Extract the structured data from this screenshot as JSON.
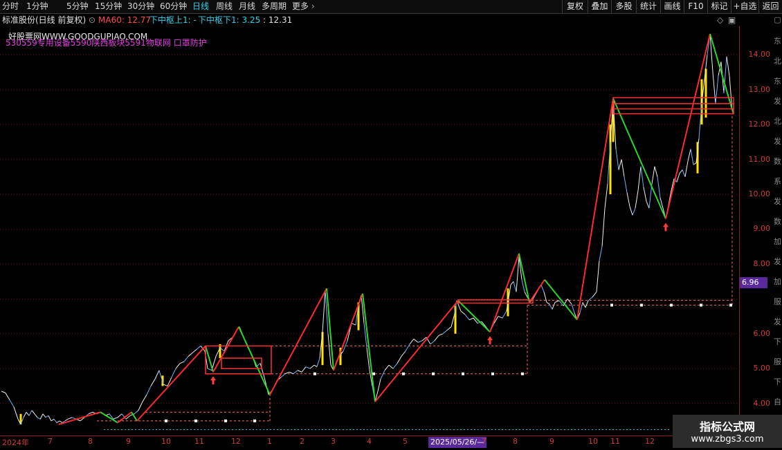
{
  "toolbar": {
    "left_items": [
      {
        "label": "分时",
        "x": 3
      },
      {
        "label": "1分钟",
        "x": 38
      },
      {
        "label": "5分钟",
        "x": 96
      },
      {
        "label": "15分钟",
        "x": 137
      },
      {
        "label": "30分钟",
        "x": 184
      },
      {
        "label": "60分钟",
        "x": 231
      },
      {
        "label": "日线",
        "x": 278
      },
      {
        "label": "周线",
        "x": 312
      },
      {
        "label": "月线",
        "x": 345
      },
      {
        "label": "多周期",
        "x": 378
      },
      {
        "label": "更多",
        "x": 422
      }
    ],
    "more_caret": "›",
    "active": "日线",
    "right_items": [
      "复权",
      "叠加",
      "多股",
      "统计",
      "画线",
      "F10",
      "标记",
      "+自选",
      "返回"
    ]
  },
  "info": {
    "title": "标准股份(日线 前复权)",
    "ma": "MA60: 12.77",
    "zs_up": "下中枢上1: -",
    "zs_down": "下中枢下1: 3.25",
    "val": ": 12.31",
    "site_watermark": "好股票网WWW.GOODGUPIAO.COM",
    "concepts": "530559专用设备5590陕西板块5591物联网 口罩防护"
  },
  "colors": {
    "up": "#ff2a2a",
    "down": "#28d82a",
    "price_line": "#f0f0f0",
    "price_line_alt": "#6fb4ff",
    "yellow_bar": "#ffe200",
    "box": "#ff3030",
    "axis_label": "#d23c3c",
    "accent": "#27d3f0",
    "badge": "#5a2a9c"
  },
  "yaxis": {
    "labels": [
      "14.00",
      "13.00",
      "12.00",
      "11.00",
      "10.00",
      "9.00",
      "8.00",
      "6.00",
      "5.00",
      "4.00"
    ],
    "current_price": "6.96"
  },
  "xaxis": {
    "labels": [
      "2024年",
      "7",
      "8",
      "9",
      "10",
      "11",
      "12",
      "1",
      "2",
      "3",
      "4",
      "5",
      "7",
      "8",
      "9",
      "10",
      "11",
      "12"
    ],
    "date_badge": "2025/05/26/—"
  },
  "right_strip": [
    "▢",
    "东",
    "北",
    "东",
    "发",
    "北",
    "发",
    "数",
    "系",
    "发",
    "数",
    "加",
    "发",
    "加",
    "服",
    "发",
    "下",
    "服",
    "下",
    "自",
    "农"
  ],
  "watermark": {
    "line1": "指标公式网",
    "line2": "www.zbgs3.com"
  },
  "chart_data": {
    "type": "line",
    "ylim": [
      3.2,
      14.7
    ],
    "x_range": [
      0,
      1060
    ],
    "price_series": [
      [
        2,
        4.35
      ],
      [
        8,
        4.3
      ],
      [
        14,
        4.1
      ],
      [
        20,
        3.9
      ],
      [
        26,
        3.55
      ],
      [
        30,
        3.4
      ],
      [
        34,
        3.6
      ],
      [
        38,
        3.75
      ],
      [
        42,
        3.65
      ],
      [
        46,
        3.8
      ],
      [
        50,
        3.7
      ],
      [
        54,
        3.6
      ],
      [
        58,
        3.55
      ],
      [
        62,
        3.7
      ],
      [
        66,
        3.6
      ],
      [
        70,
        3.65
      ],
      [
        74,
        3.5
      ],
      [
        78,
        3.55
      ],
      [
        82,
        3.45
      ],
      [
        86,
        3.5
      ],
      [
        90,
        3.45
      ],
      [
        94,
        3.5
      ],
      [
        98,
        3.55
      ],
      [
        104,
        3.6
      ],
      [
        110,
        3.55
      ],
      [
        116,
        3.5
      ],
      [
        122,
        3.6
      ],
      [
        128,
        3.7
      ],
      [
        134,
        3.75
      ],
      [
        140,
        3.7
      ],
      [
        146,
        3.75
      ],
      [
        152,
        3.65
      ],
      [
        158,
        3.7
      ],
      [
        164,
        3.55
      ],
      [
        170,
        3.6
      ],
      [
        176,
        3.7
      ],
      [
        182,
        3.55
      ],
      [
        188,
        3.65
      ],
      [
        194,
        3.7
      ],
      [
        200,
        3.8
      ],
      [
        206,
        4.05
      ],
      [
        212,
        4.25
      ],
      [
        218,
        4.5
      ],
      [
        224,
        4.7
      ],
      [
        230,
        4.95
      ],
      [
        236,
        4.55
      ],
      [
        242,
        4.5
      ],
      [
        248,
        4.75
      ],
      [
        254,
        5.0
      ],
      [
        260,
        5.15
      ],
      [
        266,
        5.2
      ],
      [
        272,
        5.35
      ],
      [
        278,
        5.45
      ],
      [
        284,
        5.55
      ],
      [
        290,
        5.65
      ],
      [
        296,
        5.5
      ],
      [
        300,
        5.0
      ],
      [
        306,
        4.95
      ],
      [
        312,
        5.35
      ],
      [
        318,
        5.6
      ],
      [
        324,
        5.5
      ],
      [
        330,
        5.8
      ],
      [
        336,
        5.9
      ],
      [
        342,
        6.1
      ],
      [
        346,
        6.2
      ],
      [
        352,
        5.9
      ],
      [
        358,
        5.6
      ],
      [
        364,
        5.4
      ],
      [
        370,
        5.05
      ],
      [
        376,
        5.15
      ],
      [
        382,
        4.75
      ],
      [
        388,
        4.25
      ],
      [
        394,
        4.4
      ],
      [
        400,
        4.65
      ],
      [
        406,
        4.75
      ],
      [
        412,
        4.85
      ],
      [
        418,
        4.9
      ],
      [
        424,
        4.85
      ],
      [
        430,
        4.95
      ],
      [
        436,
        4.9
      ],
      [
        442,
        5.05
      ],
      [
        448,
        5.0
      ],
      [
        454,
        5.1
      ],
      [
        458,
        5.05
      ],
      [
        462,
        5.3
      ],
      [
        466,
        6.05
      ],
      [
        470,
        7.25
      ],
      [
        474,
        6.0
      ],
      [
        478,
        5.1
      ],
      [
        482,
        4.95
      ],
      [
        486,
        5.2
      ],
      [
        490,
        5.35
      ],
      [
        496,
        5.5
      ],
      [
        502,
        5.8
      ],
      [
        508,
        6.3
      ],
      [
        514,
        6.25
      ],
      [
        518,
        6.85
      ],
      [
        522,
        7.1
      ],
      [
        526,
        6.3
      ],
      [
        530,
        5.6
      ],
      [
        534,
        4.95
      ],
      [
        538,
        4.5
      ],
      [
        542,
        4.05
      ],
      [
        546,
        4.35
      ],
      [
        550,
        4.7
      ],
      [
        556,
        4.95
      ],
      [
        562,
        5.1
      ],
      [
        568,
        5.0
      ],
      [
        574,
        5.15
      ],
      [
        580,
        5.35
      ],
      [
        586,
        5.5
      ],
      [
        592,
        5.7
      ],
      [
        598,
        5.85
      ],
      [
        604,
        5.75
      ],
      [
        610,
        5.8
      ],
      [
        616,
        5.9
      ],
      [
        622,
        5.7
      ],
      [
        628,
        5.8
      ],
      [
        634,
        5.95
      ],
      [
        640,
        6.0
      ],
      [
        646,
        6.1
      ],
      [
        652,
        6.2
      ],
      [
        656,
        6.5
      ],
      [
        660,
        6.95
      ],
      [
        666,
        6.65
      ],
      [
        672,
        6.55
      ],
      [
        678,
        6.4
      ],
      [
        684,
        6.45
      ],
      [
        690,
        6.3
      ],
      [
        696,
        6.35
      ],
      [
        702,
        6.2
      ],
      [
        708,
        6.05
      ],
      [
        714,
        6.3
      ],
      [
        720,
        6.5
      ],
      [
        726,
        6.45
      ],
      [
        732,
        6.65
      ],
      [
        738,
        7.4
      ],
      [
        742,
        7.5
      ],
      [
        746,
        7.2
      ],
      [
        750,
        8.2
      ],
      [
        754,
        7.55
      ],
      [
        758,
        7.2
      ],
      [
        762,
        7.05
      ],
      [
        766,
        6.9
      ],
      [
        770,
        7.0
      ],
      [
        776,
        7.2
      ],
      [
        782,
        7.4
      ],
      [
        786,
        7.2
      ],
      [
        790,
        6.9
      ],
      [
        794,
        6.85
      ],
      [
        798,
        6.7
      ],
      [
        802,
        6.9
      ],
      [
        808,
        6.95
      ],
      [
        814,
        6.8
      ],
      [
        820,
        7.0
      ],
      [
        826,
        6.85
      ],
      [
        830,
        6.6
      ],
      [
        834,
        6.4
      ],
      [
        838,
        6.6
      ],
      [
        842,
        6.9
      ],
      [
        846,
        6.75
      ],
      [
        850,
        6.95
      ],
      [
        856,
        7.05
      ],
      [
        862,
        7.2
      ],
      [
        866,
        8.1
      ],
      [
        870,
        8.5
      ],
      [
        874,
        9.6
      ],
      [
        878,
        10.3
      ],
      [
        882,
        11.5
      ],
      [
        886,
        12.7
      ],
      [
        890,
        11.3
      ],
      [
        894,
        10.7
      ],
      [
        898,
        11.0
      ],
      [
        902,
        10.5
      ],
      [
        906,
        10.05
      ],
      [
        910,
        9.65
      ],
      [
        914,
        9.4
      ],
      [
        918,
        9.6
      ],
      [
        922,
        10.1
      ],
      [
        926,
        10.8
      ],
      [
        930,
        10.2
      ],
      [
        934,
        9.8
      ],
      [
        938,
        9.6
      ],
      [
        942,
        10.3
      ],
      [
        946,
        10.8
      ],
      [
        950,
        10.5
      ],
      [
        954,
        9.9
      ],
      [
        958,
        9.6
      ],
      [
        962,
        9.3
      ],
      [
        966,
        9.7
      ],
      [
        970,
        10.1
      ],
      [
        974,
        10.45
      ],
      [
        978,
        10.35
      ],
      [
        982,
        10.6
      ],
      [
        986,
        10.7
      ],
      [
        990,
        10.5
      ],
      [
        994,
        10.95
      ],
      [
        998,
        11.3
      ],
      [
        1002,
        10.85
      ],
      [
        1006,
        10.9
      ],
      [
        1010,
        11.6
      ],
      [
        1014,
        12.6
      ],
      [
        1018,
        13.3
      ],
      [
        1022,
        14.0
      ],
      [
        1026,
        14.6
      ],
      [
        1030,
        13.5
      ],
      [
        1034,
        12.6
      ],
      [
        1038,
        13.4
      ],
      [
        1042,
        13.8
      ],
      [
        1046,
        12.9
      ],
      [
        1050,
        13.95
      ],
      [
        1054,
        13.4
      ],
      [
        1058,
        12.4
      ]
    ],
    "zigzag": [
      [
        85,
        3.4
      ],
      [
        145,
        3.75
      ],
      [
        170,
        3.45
      ],
      [
        190,
        3.75
      ],
      [
        198,
        3.5
      ],
      [
        297,
        5.65
      ],
      [
        308,
        4.9
      ],
      [
        345,
        6.2
      ],
      [
        390,
        4.25
      ],
      [
        472,
        7.3
      ],
      [
        482,
        4.95
      ],
      [
        524,
        7.15
      ],
      [
        542,
        4.05
      ],
      [
        662,
        6.95
      ],
      [
        708,
        6.05
      ],
      [
        750,
        8.3
      ],
      [
        765,
        6.9
      ],
      [
        787,
        7.55
      ],
      [
        834,
        6.4
      ],
      [
        886,
        12.75
      ],
      [
        962,
        9.3
      ],
      [
        1026,
        14.6
      ],
      [
        1060,
        12.3
      ]
    ],
    "boxes": [
      {
        "x1": 297,
        "x2": 392,
        "y_top": 5.65,
        "y_bot": 4.85
      },
      {
        "x1": 320,
        "x2": 378,
        "y_top": 5.3,
        "y_bot": 5.0
      },
      {
        "x1": 662,
        "x2": 770,
        "y_top": 6.97,
        "y_bot": 6.88
      },
      {
        "x1": 886,
        "x2": 1060,
        "y_top": 12.77,
        "y_bot": 12.31
      }
    ],
    "dashed_levels": [
      {
        "x1": 210,
        "x2": 390,
        "y": 3.75
      },
      {
        "x1": 140,
        "x2": 390,
        "y": 3.5
      },
      {
        "x1": 392,
        "x2": 762,
        "y": 5.65
      },
      {
        "x1": 392,
        "x2": 762,
        "y": 4.85
      },
      {
        "x1": 762,
        "x2": 1058,
        "y": 6.96
      },
      {
        "x1": 762,
        "x2": 1058,
        "y": 6.82
      }
    ],
    "dashed_verticals": [
      {
        "x": 390,
        "y1": 3.5,
        "y2": 4.25
      },
      {
        "x": 762,
        "y1": 4.85,
        "y2": 6.9
      },
      {
        "x": 1058,
        "y1": 6.82,
        "y2": 12.3
      }
    ],
    "cyan_level": 3.25,
    "yellow_bars": [
      [
        30,
        3.4,
        3.7
      ],
      [
        235,
        4.5,
        4.8
      ],
      [
        318,
        5.3,
        5.7
      ],
      [
        466,
        5.1,
        6.05
      ],
      [
        492,
        5.1,
        5.6
      ],
      [
        518,
        6.1,
        6.9
      ],
      [
        658,
        6.0,
        6.8
      ],
      [
        734,
        6.5,
        7.3
      ],
      [
        882,
        10.0,
        12.0
      ],
      [
        886,
        11.5,
        12.7
      ],
      [
        1008,
        10.6,
        11.5
      ],
      [
        1014,
        12.0,
        13.3
      ],
      [
        1020,
        12.2,
        13.6
      ]
    ],
    "buy_arrows": [
      [
        308,
        4.9
      ],
      [
        708,
        6.05
      ],
      [
        962,
        9.3
      ]
    ]
  }
}
